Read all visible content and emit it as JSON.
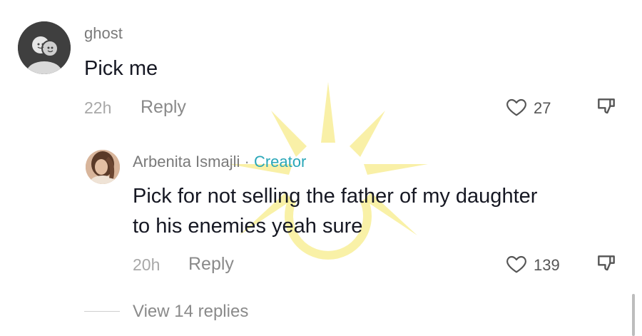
{
  "comments": [
    {
      "username": "ghost",
      "text": "Pick me",
      "time": "22h",
      "reply_label": "Reply",
      "likes": "27"
    },
    {
      "username": "Arbenita Ismajli",
      "separator": "·",
      "badge": "Creator",
      "text_line1": "Pick for not selling the father of my daughter",
      "text_line2": "to his enemies yeah sure",
      "time": "20h",
      "reply_label": "Reply",
      "likes": "139"
    }
  ],
  "view_replies_label": "View 14 replies",
  "colors": {
    "creator_badge": "#2aa7b8",
    "watermark": "#f7ec8a"
  }
}
